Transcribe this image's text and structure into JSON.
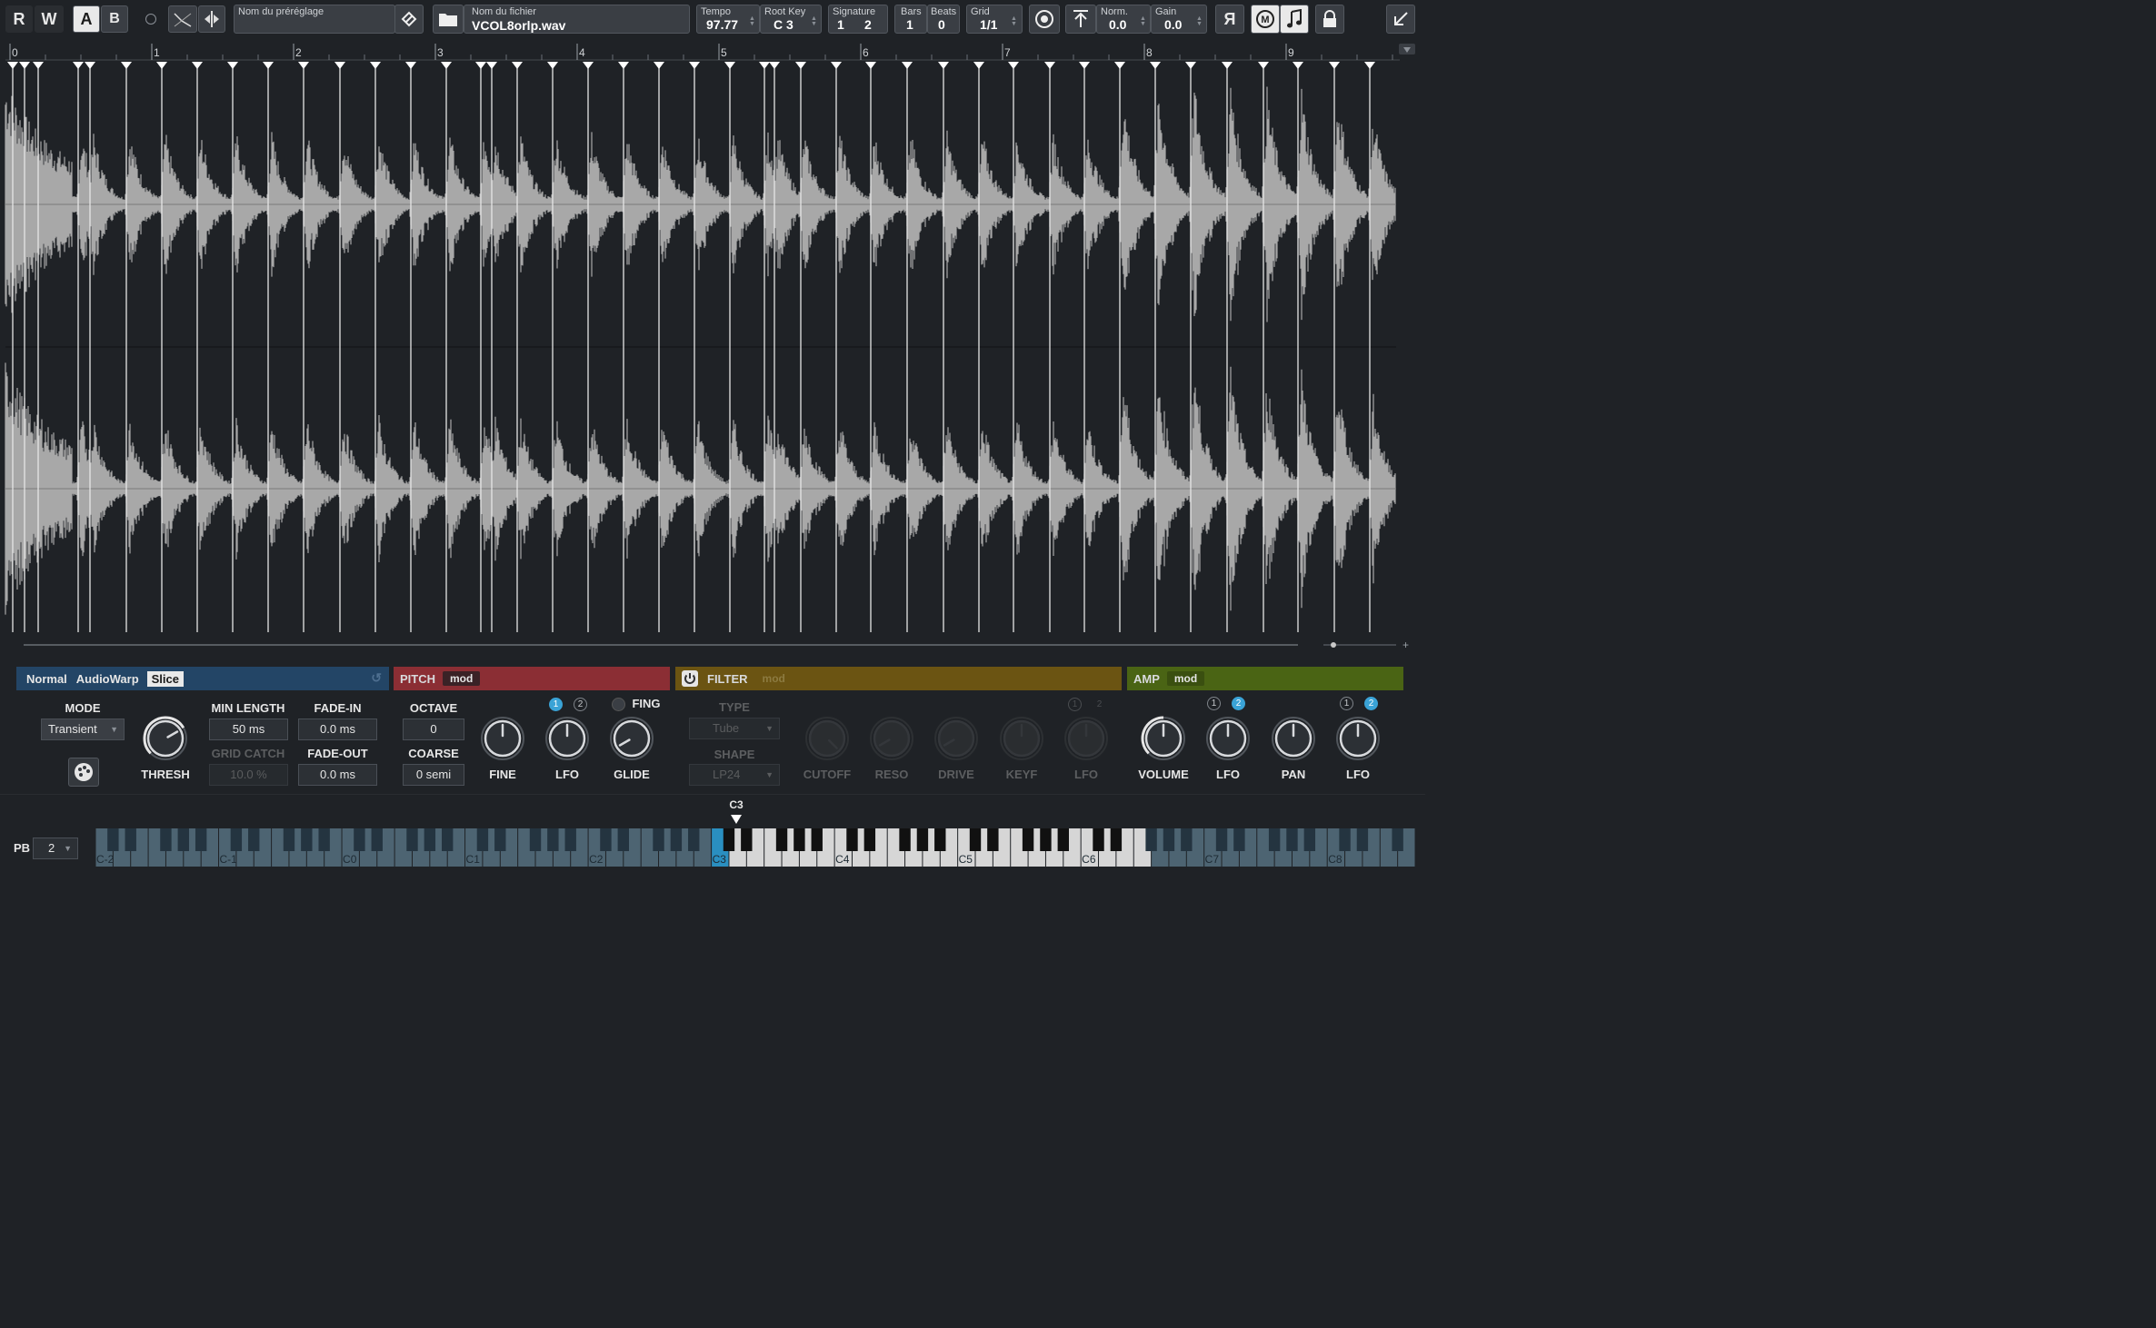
{
  "toolbar": {
    "r_label": "R",
    "w_label": "W",
    "a_label": "A",
    "b_label": "B",
    "preset_caption": "Nom du préréglage",
    "file_caption": "Nom du fichier",
    "file_name": "VCOL8orlp.wav",
    "tempo_label": "Tempo",
    "tempo_value": "97.77",
    "rootkey_label": "Root Key",
    "rootkey_value": "C 3",
    "signature_label": "Signature",
    "signature_num": "1",
    "signature_den": "2",
    "bars_label": "Bars",
    "bars_value": "1",
    "beats_label": "Beats",
    "beats_value": "0",
    "grid_label": "Grid",
    "grid_value": "1/1",
    "norm_label": "Norm.",
    "norm_value": "0.0",
    "gain_label": "Gain",
    "gain_value": "0.0",
    "reverse_label": "Я"
  },
  "ruler": {
    "bars": [
      "0",
      "1",
      "2",
      "3",
      "4",
      "5",
      "6",
      "7",
      "8",
      "9"
    ]
  },
  "slice_panel": {
    "tabs": [
      "Normal",
      "AudioWarp",
      "Slice"
    ],
    "active_tab": "Slice",
    "mode_label": "MODE",
    "mode_value": "Transient",
    "thresh_label": "THRESH",
    "min_length_label": "MIN LENGTH",
    "min_length_value": "50 ms",
    "fade_in_label": "FADE-IN",
    "fade_in_value": "0.0 ms",
    "grid_catch_label": "GRID CATCH",
    "grid_catch_value": "10.0 %",
    "fade_out_label": "FADE-OUT",
    "fade_out_value": "0.0 ms"
  },
  "pitch_panel": {
    "title": "PITCH",
    "mod_label": "mod",
    "octave_label": "OCTAVE",
    "octave_value": "0",
    "coarse_label": "COARSE",
    "coarse_value": "0 semi",
    "fine_label": "FINE",
    "lfo_label": "LFO",
    "glide_label": "GLIDE",
    "fing_label": "FING",
    "lfo_badges": [
      "1",
      "2"
    ]
  },
  "filter_panel": {
    "title": "FILTER",
    "mod_label": "mod",
    "type_label": "TYPE",
    "type_value": "Tube",
    "shape_label": "SHAPE",
    "shape_value": "LP24",
    "cutoff_label": "CUTOFF",
    "reso_label": "RESO",
    "drive_label": "DRIVE",
    "keyf_label": "KEYF",
    "lfo_label": "LFO",
    "lfo_badges": [
      "1",
      "2"
    ]
  },
  "amp_panel": {
    "title": "AMP",
    "mod_label": "mod",
    "volume_label": "VOLUME",
    "lfo1_label": "LFO",
    "pan_label": "PAN",
    "lfo2_label": "LFO",
    "lfo_badges": [
      "1",
      "2"
    ]
  },
  "keyboard": {
    "pb_label": "PB",
    "pb_value": "2",
    "root_marker": "C3",
    "octave_labels": [
      "C-2",
      "C-1",
      "C0",
      "C1",
      "C2",
      "C3",
      "C4",
      "C5",
      "C6",
      "C7",
      "C8"
    ]
  },
  "colors": {
    "slice_accent": "#2c5f8f",
    "pitch_accent": "#8b2e34",
    "filter_accent": "#6b5412",
    "amp_accent": "#4a6414",
    "waveform": "#a8a8a8",
    "active_blue": "#3aa3d6"
  }
}
